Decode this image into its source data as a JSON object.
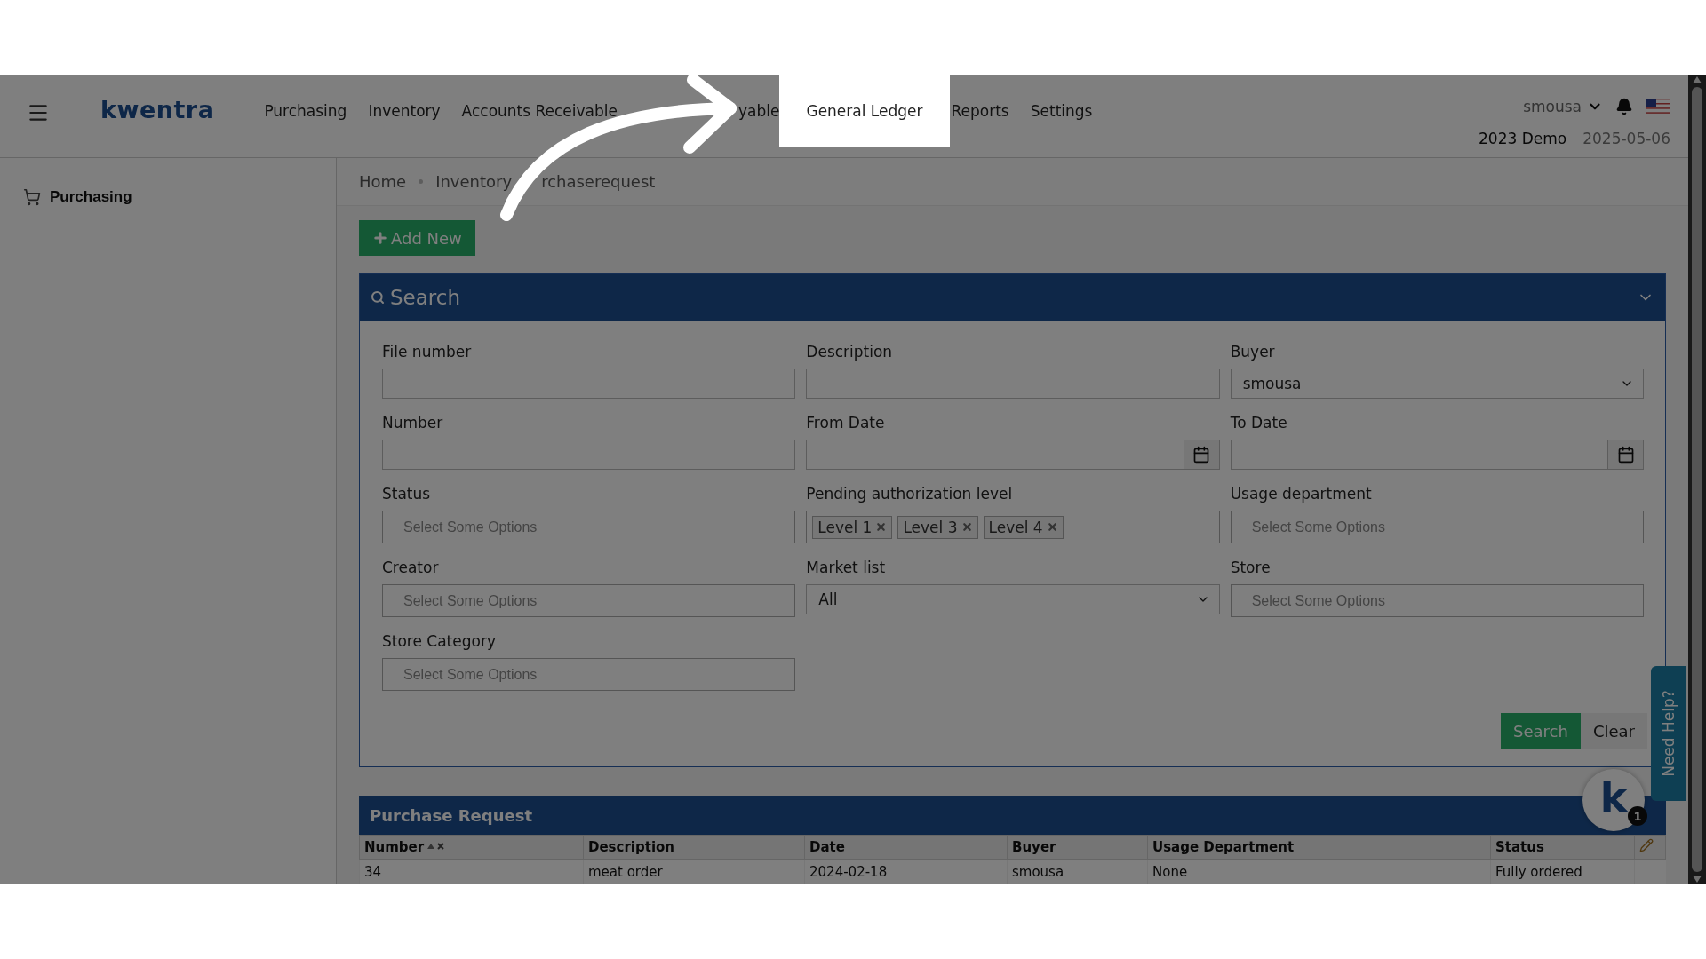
{
  "header": {
    "logo": "kwentra",
    "nav": [
      {
        "label": "Purchasing",
        "highlighted": false
      },
      {
        "label": "Inventory",
        "highlighted": false
      },
      {
        "label": "Accounts Receivable",
        "highlighted": false
      },
      {
        "label": "yable",
        "highlighted": false
      },
      {
        "label": "General Ledger",
        "highlighted": true
      },
      {
        "label": "Reports",
        "highlighted": false
      },
      {
        "label": "Settings",
        "highlighted": false
      }
    ],
    "user": "smousa",
    "company": "2023 Demo",
    "date": "2025-05-06"
  },
  "sidebar": {
    "items": [
      {
        "label": "Purchasing"
      }
    ]
  },
  "breadcrumb": [
    "Home",
    "Inventory",
    "rchaserequest"
  ],
  "add_button": "Add New",
  "search_panel": {
    "title": "Search",
    "fields": [
      {
        "label": "File number",
        "kind": "text"
      },
      {
        "label": "Description",
        "kind": "text"
      },
      {
        "label": "Buyer",
        "kind": "select",
        "value": "smousa"
      },
      {
        "label": "Number",
        "kind": "text"
      },
      {
        "label": "From Date",
        "kind": "date"
      },
      {
        "label": "To Date",
        "kind": "date"
      },
      {
        "label": "Status",
        "kind": "multi",
        "placeholder": "Select Some Options"
      },
      {
        "label": "Pending authorization level",
        "kind": "multi",
        "tags": [
          "Level 1",
          "Level 3",
          "Level 4"
        ]
      },
      {
        "label": "Usage department",
        "kind": "multi",
        "placeholder": "Select Some Options"
      },
      {
        "label": "Creator",
        "kind": "multi",
        "placeholder": "Select Some Options"
      },
      {
        "label": "Market list",
        "kind": "select",
        "value": "All"
      },
      {
        "label": "Store",
        "kind": "multi",
        "placeholder": "Select Some Options"
      },
      {
        "label": "Store Category",
        "kind": "multi",
        "placeholder": "Select Some Options"
      }
    ],
    "buttons": [
      "Search",
      "Clear"
    ]
  },
  "table": {
    "title": "Purchase Request",
    "columns": [
      {
        "label": "Number",
        "sorted": true
      },
      {
        "label": "Description",
        "sorted": false
      },
      {
        "label": "Date",
        "sorted": false
      },
      {
        "label": "Buyer",
        "sorted": false
      },
      {
        "label": "Usage Department",
        "sorted": false
      },
      {
        "label": "Status",
        "sorted": false
      }
    ],
    "rows": [
      [
        "34",
        "meat order",
        "2024-02-18",
        "smousa",
        "None",
        "Fully ordered"
      ]
    ]
  },
  "help": {
    "label": "Need Help?"
  },
  "chat": {
    "logo": "k",
    "badge": "1"
  }
}
